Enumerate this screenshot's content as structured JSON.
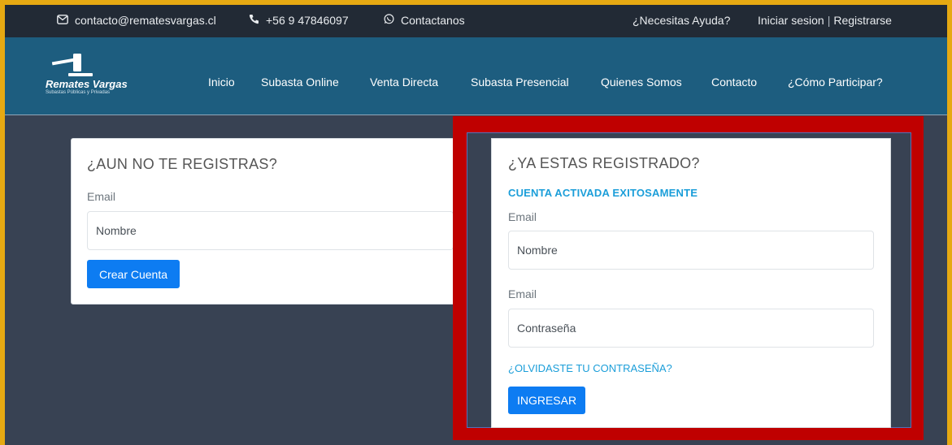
{
  "topbar": {
    "email": "contacto@rematesvargas.cl",
    "phone": "+56 9 47846097",
    "whatsapp": "Contactanos",
    "help": "¿Necesitas Ayuda?",
    "login": "Iniciar sesion",
    "separator": "|",
    "register": "Registrarse"
  },
  "logo": {
    "brand": "Remates Vargas",
    "tagline": "Subastas Públicas y Privadas"
  },
  "nav": {
    "items": [
      "Inicio",
      "Subasta Online",
      "Venta Directa",
      "Subasta Presencial",
      "Quienes Somos",
      "Contacto",
      "¿Cómo Participar?"
    ]
  },
  "register_card": {
    "title": "¿AUN NO TE REGISTRAS?",
    "email_label": "Email",
    "email_placeholder": "Nombre",
    "button": "Crear Cuenta"
  },
  "login_card": {
    "title": "¿YA ESTAS REGISTRADO?",
    "status": "CUENTA ACTIVADA EXITOSAMENTE",
    "email_label": "Email",
    "email_placeholder": "Nombre",
    "password_label": "Email",
    "password_placeholder": "Contraseña",
    "forgot": "¿OLVIDASTE TU CONTRASEÑA?",
    "button": "INGRESAR"
  },
  "colors": {
    "outer_border": "#e6a912",
    "highlight": "#bf0000",
    "navbar": "#1d5d7f",
    "topbar": "#222a35",
    "background": "#384253",
    "primary_button": "#0d7cf2",
    "link": "#1b9ed9"
  }
}
